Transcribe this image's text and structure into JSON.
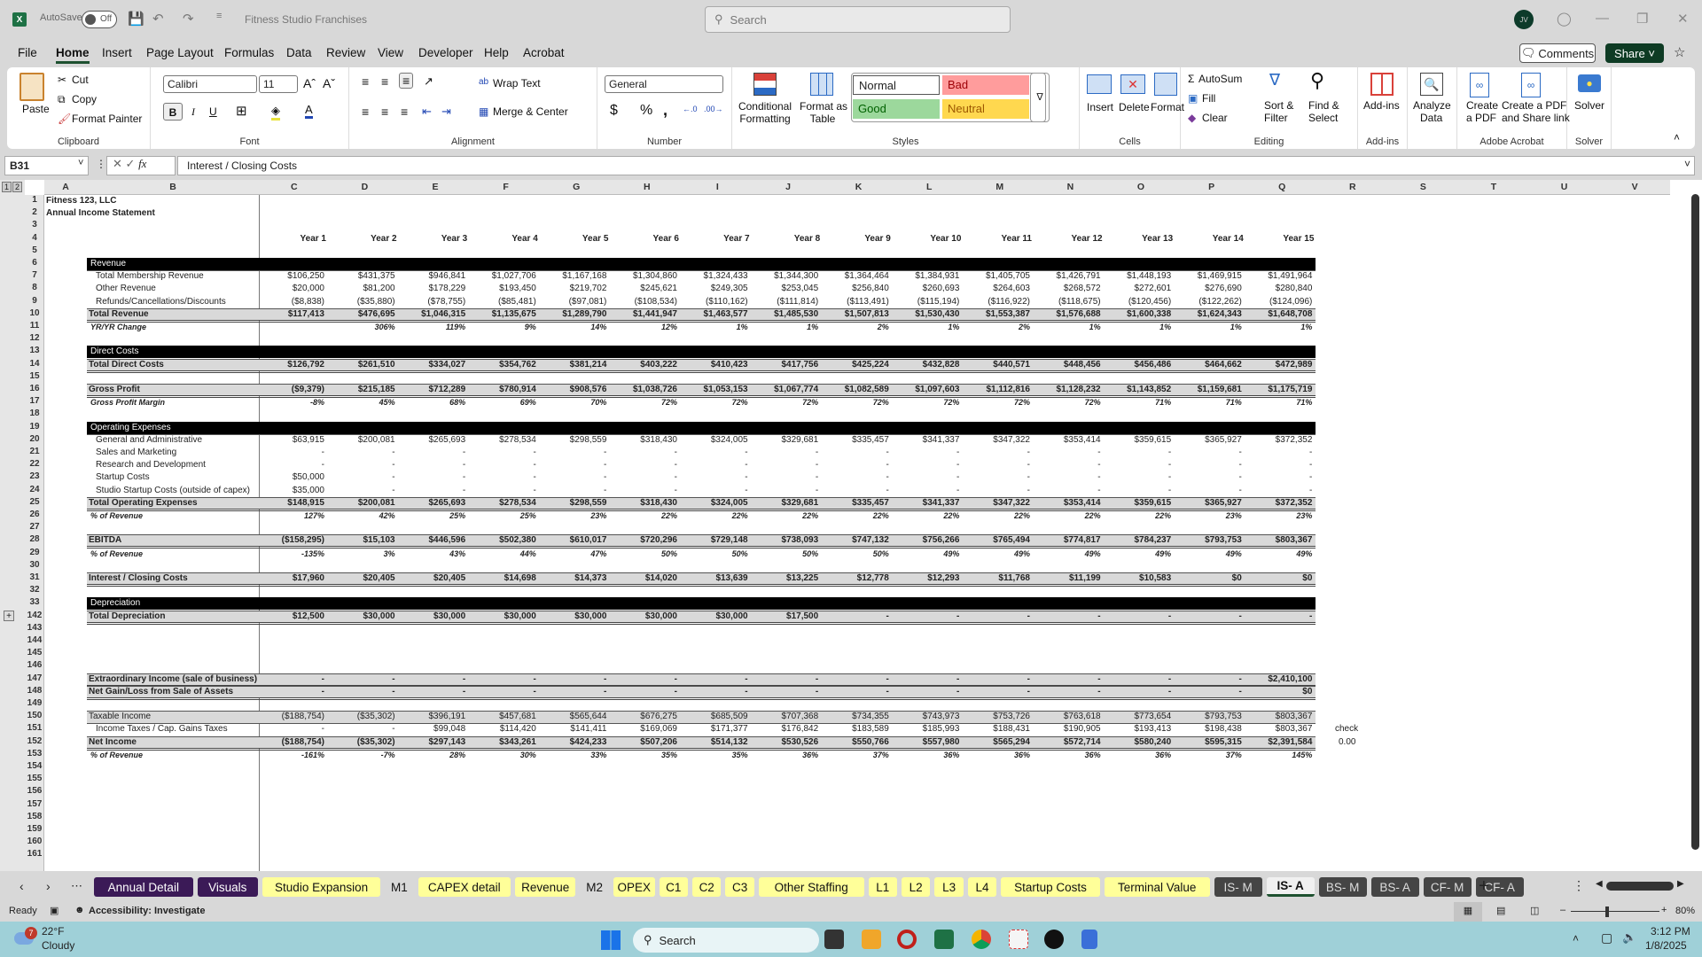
{
  "titlebar": {
    "autosave_label": "AutoSave",
    "autosave_state": "Off",
    "doc_title": "Fitness Studio Franchises",
    "search_placeholder": "Search",
    "avatar_initials": "JV"
  },
  "menu": {
    "items": [
      "File",
      "Home",
      "Insert",
      "Page Layout",
      "Formulas",
      "Data",
      "Review",
      "View",
      "Developer",
      "Help",
      "Acrobat"
    ],
    "active": "Home",
    "comments": "Comments",
    "share": "Share"
  },
  "ribbon": {
    "clipboard": {
      "paste": "Paste",
      "cut": "Cut",
      "copy": "Copy",
      "format_painter": "Format Painter",
      "label": "Clipboard"
    },
    "font": {
      "name": "Calibri",
      "size": "11",
      "label": "Font",
      "bold": "B",
      "italic": "I",
      "underline": "U"
    },
    "alignment": {
      "wrap_text": "Wrap Text",
      "merge_center": "Merge & Center",
      "label": "Alignment"
    },
    "number": {
      "format": "General",
      "label": "Number",
      "currency": "$",
      "percent": "%",
      "comma": ","
    },
    "styles": {
      "conditional": "Conditional",
      "conditional2": "Formatting",
      "format_table": "Format as",
      "format_table2": "Table",
      "normal": "Normal",
      "bad": "Bad",
      "good": "Good",
      "neutral": "Neutral",
      "label": "Styles"
    },
    "cells": {
      "insert": "Insert",
      "delete": "Delete",
      "format": "Format",
      "label": "Cells"
    },
    "editing": {
      "autosum": "AutoSum",
      "fill": "Fill",
      "clear": "Clear",
      "sort": "Sort &",
      "sort2": "Filter",
      "find": "Find &",
      "find2": "Select",
      "label": "Editing"
    },
    "addins": {
      "addins": "Add-ins",
      "label": "Add-ins"
    },
    "analyze": {
      "l1": "Analyze",
      "l2": "Data"
    },
    "acrobat": {
      "create1": "Create",
      "create2": "a PDF",
      "share1": "Create a PDF",
      "share2": "and Share link",
      "label": "Adobe Acrobat"
    },
    "solver": {
      "solver": "Solver",
      "label": "Solver"
    }
  },
  "formula_bar": {
    "name_box": "B31",
    "formula": "Interest / Closing Costs"
  },
  "columns": [
    "A",
    "B",
    "C",
    "D",
    "E",
    "F",
    "G",
    "H",
    "I",
    "J",
    "K",
    "L",
    "M",
    "N",
    "O",
    "P",
    "Q",
    "R",
    "S",
    "T",
    "U",
    "V"
  ],
  "row_numbers": [
    "1",
    "2",
    "3",
    "4",
    "5",
    "6",
    "7",
    "8",
    "9",
    "10",
    "11",
    "12",
    "13",
    "14",
    "15",
    "16",
    "17",
    "18",
    "19",
    "20",
    "21",
    "22",
    "23",
    "24",
    "25",
    "26",
    "27",
    "28",
    "29",
    "30",
    "31",
    "32",
    "33",
    "142",
    "143",
    "144",
    "145",
    "146",
    "147",
    "148",
    "149",
    "150",
    "151",
    "152",
    "153",
    "154",
    "155",
    "156",
    "157",
    "158",
    "159",
    "160",
    "161"
  ],
  "sheet": {
    "company": "Fitness 123, LLC",
    "title": "Annual Income Statement",
    "years": [
      "Year 1",
      "Year 2",
      "Year 3",
      "Year 4",
      "Year 5",
      "Year 6",
      "Year 7",
      "Year 8",
      "Year 9",
      "Year 10",
      "Year 11",
      "Year 12",
      "Year 13",
      "Year 14",
      "Year 15"
    ],
    "sections": {
      "revenue": "Revenue",
      "direct": "Direct Costs",
      "opex": "Operating Expenses",
      "depreciation": "Depreciation"
    },
    "rows": [
      {
        "label": "Total Membership Revenue",
        "values": [
          "$106,250",
          "$431,375",
          "$946,841",
          "$1,027,706",
          "$1,167,168",
          "$1,304,860",
          "$1,324,433",
          "$1,344,300",
          "$1,364,464",
          "$1,384,931",
          "$1,405,705",
          "$1,426,791",
          "$1,448,193",
          "$1,469,915",
          "$1,491,964"
        ]
      },
      {
        "label": "Other Revenue",
        "values": [
          "$20,000",
          "$81,200",
          "$178,229",
          "$193,450",
          "$219,702",
          "$245,621",
          "$249,305",
          "$253,045",
          "$256,840",
          "$260,693",
          "$264,603",
          "$268,572",
          "$272,601",
          "$276,690",
          "$280,840"
        ]
      },
      {
        "label": "Refunds/Cancellations/Discounts",
        "values": [
          "($8,838)",
          "($35,880)",
          "($78,755)",
          "($85,481)",
          "($97,081)",
          "($108,534)",
          "($110,162)",
          "($111,814)",
          "($113,491)",
          "($115,194)",
          "($116,922)",
          "($118,675)",
          "($120,456)",
          "($122,262)",
          "($124,096)"
        ]
      },
      {
        "label": "Total Revenue",
        "values": [
          "$117,413",
          "$476,695",
          "$1,046,315",
          "$1,135,675",
          "$1,289,790",
          "$1,441,947",
          "$1,463,577",
          "$1,485,530",
          "$1,507,813",
          "$1,530,430",
          "$1,553,387",
          "$1,576,688",
          "$1,600,338",
          "$1,624,343",
          "$1,648,708"
        ]
      },
      {
        "label": "YR/YR Change",
        "values": [
          "",
          "306%",
          "119%",
          "9%",
          "14%",
          "12%",
          "1%",
          "1%",
          "2%",
          "1%",
          "2%",
          "1%",
          "1%",
          "1%",
          "1%"
        ]
      },
      {
        "label": "Total Direct Costs",
        "values": [
          "$126,792",
          "$261,510",
          "$334,027",
          "$354,762",
          "$381,214",
          "$403,222",
          "$410,423",
          "$417,756",
          "$425,224",
          "$432,828",
          "$440,571",
          "$448,456",
          "$456,486",
          "$464,662",
          "$472,989"
        ]
      },
      {
        "label": "Gross Profit",
        "values": [
          "($9,379)",
          "$215,185",
          "$712,289",
          "$780,914",
          "$908,576",
          "$1,038,726",
          "$1,053,153",
          "$1,067,774",
          "$1,082,589",
          "$1,097,603",
          "$1,112,816",
          "$1,128,232",
          "$1,143,852",
          "$1,159,681",
          "$1,175,719"
        ]
      },
      {
        "label": "Gross Profit Margin",
        "values": [
          "-8%",
          "45%",
          "68%",
          "69%",
          "70%",
          "72%",
          "72%",
          "72%",
          "72%",
          "72%",
          "72%",
          "72%",
          "71%",
          "71%",
          "71%"
        ]
      },
      {
        "label": "General and Administrative",
        "values": [
          "$63,915",
          "$200,081",
          "$265,693",
          "$278,534",
          "$298,559",
          "$318,430",
          "$324,005",
          "$329,681",
          "$335,457",
          "$341,337",
          "$347,322",
          "$353,414",
          "$359,615",
          "$365,927",
          "$372,352"
        ]
      },
      {
        "label": "Sales and Marketing",
        "values": [
          "-",
          "-",
          "-",
          "-",
          "-",
          "-",
          "-",
          "-",
          "-",
          "-",
          "-",
          "-",
          "-",
          "-",
          "-"
        ]
      },
      {
        "label": "Research and Development",
        "values": [
          "-",
          "-",
          "-",
          "-",
          "-",
          "-",
          "-",
          "-",
          "-",
          "-",
          "-",
          "-",
          "-",
          "-",
          "-"
        ]
      },
      {
        "label": "Startup Costs",
        "values": [
          "$50,000",
          "-",
          "-",
          "-",
          "-",
          "-",
          "-",
          "-",
          "-",
          "-",
          "-",
          "-",
          "-",
          "-",
          "-"
        ]
      },
      {
        "label": "Studio Startup Costs (outside of capex)",
        "values": [
          "$35,000",
          "-",
          "-",
          "-",
          "-",
          "-",
          "-",
          "-",
          "-",
          "-",
          "-",
          "-",
          "-",
          "-",
          "-"
        ]
      },
      {
        "label": "Total Operating Expenses",
        "values": [
          "$148,915",
          "$200,081",
          "$265,693",
          "$278,534",
          "$298,559",
          "$318,430",
          "$324,005",
          "$329,681",
          "$335,457",
          "$341,337",
          "$347,322",
          "$353,414",
          "$359,615",
          "$365,927",
          "$372,352"
        ]
      },
      {
        "label": "% of Revenue",
        "values": [
          "127%",
          "42%",
          "25%",
          "25%",
          "23%",
          "22%",
          "22%",
          "22%",
          "22%",
          "22%",
          "22%",
          "22%",
          "22%",
          "23%",
          "23%"
        ]
      },
      {
        "label": "EBITDA",
        "values": [
          "($158,295)",
          "$15,103",
          "$446,596",
          "$502,380",
          "$610,017",
          "$720,296",
          "$729,148",
          "$738,093",
          "$747,132",
          "$756,266",
          "$765,494",
          "$774,817",
          "$784,237",
          "$793,753",
          "$803,367"
        ]
      },
      {
        "label": "% of Revenue",
        "values": [
          "-135%",
          "3%",
          "43%",
          "44%",
          "47%",
          "50%",
          "50%",
          "50%",
          "50%",
          "49%",
          "49%",
          "49%",
          "49%",
          "49%",
          "49%"
        ]
      },
      {
        "label": "Interest / Closing Costs",
        "values": [
          "$17,960",
          "$20,405",
          "$20,405",
          "$14,698",
          "$14,373",
          "$14,020",
          "$13,639",
          "$13,225",
          "$12,778",
          "$12,293",
          "$11,768",
          "$11,199",
          "$10,583",
          "$0",
          "$0"
        ]
      },
      {
        "label": "Total Depreciation",
        "values": [
          "$12,500",
          "$30,000",
          "$30,000",
          "$30,000",
          "$30,000",
          "$30,000",
          "$30,000",
          "$17,500",
          "-",
          "-",
          "-",
          "-",
          "-",
          "-",
          "-"
        ]
      },
      {
        "label": "Extraordinary Income (sale of business)",
        "values": [
          "-",
          "-",
          "-",
          "-",
          "-",
          "-",
          "-",
          "-",
          "-",
          "-",
          "-",
          "-",
          "-",
          "-",
          "$2,410,100"
        ]
      },
      {
        "label": "Net Gain/Loss from Sale of Assets",
        "values": [
          "-",
          "-",
          "-",
          "-",
          "-",
          "-",
          "-",
          "-",
          "-",
          "-",
          "-",
          "-",
          "-",
          "-",
          "$0"
        ]
      },
      {
        "label": "Taxable Income",
        "values": [
          "($188,754)",
          "($35,302)",
          "$396,191",
          "$457,681",
          "$565,644",
          "$676,275",
          "$685,509",
          "$707,368",
          "$734,355",
          "$743,973",
          "$753,726",
          "$763,618",
          "$773,654",
          "$793,753",
          "$803,367"
        ]
      },
      {
        "label": "Income Taxes / Cap. Gains Taxes",
        "values": [
          "-",
          "-",
          "$99,048",
          "$114,420",
          "$141,411",
          "$169,069",
          "$171,377",
          "$176,842",
          "$183,589",
          "$185,993",
          "$188,431",
          "$190,905",
          "$193,413",
          "$198,438",
          "$803,367"
        ]
      },
      {
        "label": "Net Income",
        "values": [
          "($188,754)",
          "($35,302)",
          "$297,143",
          "$343,261",
          "$424,233",
          "$507,206",
          "$514,132",
          "$530,526",
          "$550,766",
          "$557,980",
          "$565,294",
          "$572,714",
          "$580,240",
          "$595,315",
          "$2,391,584"
        ]
      },
      {
        "label": "% of Revenue",
        "values": [
          "-161%",
          "-7%",
          "28%",
          "30%",
          "33%",
          "35%",
          "35%",
          "36%",
          "37%",
          "36%",
          "36%",
          "36%",
          "36%",
          "37%",
          "145%"
        ]
      }
    ],
    "check_label": "check",
    "check_value": "0.00"
  },
  "tabs": [
    {
      "label": "Annual Detail",
      "style": "purple"
    },
    {
      "label": "Visuals",
      "style": "purple"
    },
    {
      "label": "Studio Expansion",
      "style": "yellow"
    },
    {
      "label": "M1",
      "style": "plain"
    },
    {
      "label": "CAPEX detail",
      "style": "yellow"
    },
    {
      "label": "Revenue",
      "style": "yellow"
    },
    {
      "label": "M2",
      "style": "plain"
    },
    {
      "label": "OPEX",
      "style": "yellow"
    },
    {
      "label": "C1",
      "style": "yellow"
    },
    {
      "label": "C2",
      "style": "yellow"
    },
    {
      "label": "C3",
      "style": "yellow"
    },
    {
      "label": "Other Staffing",
      "style": "yellow"
    },
    {
      "label": "L1",
      "style": "yellow"
    },
    {
      "label": "L2",
      "style": "yellow"
    },
    {
      "label": "L3",
      "style": "yellow"
    },
    {
      "label": "L4",
      "style": "yellow"
    },
    {
      "label": "Startup Costs",
      "style": "yellow"
    },
    {
      "label": "Terminal Value",
      "style": "yellow"
    },
    {
      "label": "IS- M",
      "style": "dark"
    },
    {
      "label": "IS- A",
      "style": "active"
    },
    {
      "label": "BS- M",
      "style": "dark"
    },
    {
      "label": "BS- A",
      "style": "dark"
    },
    {
      "label": "CF- M",
      "style": "dark"
    },
    {
      "label": "CF- A",
      "style": "dark"
    }
  ],
  "status": {
    "ready": "Ready",
    "accessibility": "Accessibility: Investigate",
    "zoom": "80%",
    "zoom_fraction": 0.8
  },
  "taskbar": {
    "temp": "22°F",
    "weather": "Cloudy",
    "weather_badge": "7",
    "search": "Search",
    "time": "3:12 PM",
    "date": "1/8/2025"
  }
}
